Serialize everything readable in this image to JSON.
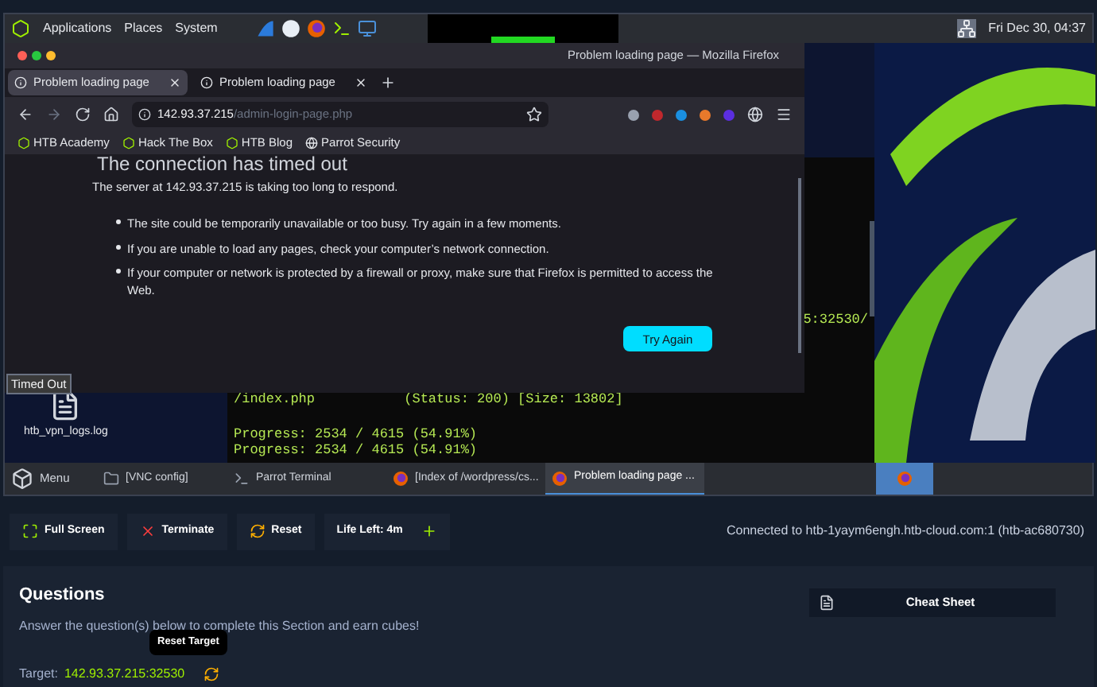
{
  "top_panel": {
    "menus": [
      "Applications",
      "Places",
      "System"
    ],
    "clock": "Fri Dec 30, 04:37"
  },
  "firefox": {
    "title": "Problem loading page — Mozilla Firefox",
    "tabs": [
      {
        "label": "Problem loading page",
        "selected": true
      },
      {
        "label": "Problem loading page",
        "selected": false
      }
    ],
    "url_host": "142.93.37.215",
    "url_path": "/admin-login-page.php",
    "bookmarks": [
      "HTB Academy",
      "Hack The Box",
      "HTB Blog",
      "Parrot Security"
    ],
    "heading": "The connection has timed out",
    "message": "The server at 142.93.37.215 is taking too long to respond.",
    "bullets": [
      "The site could be temporarily unavailable or too busy. Try again in a few moments.",
      "If you are unable to load any pages, check your computer’s network connection.",
      "If your computer or network is protected by a firewall or proxy, make sure that Firefox is permitted to access the Web."
    ],
    "button": "Try Again"
  },
  "tooltip": "Timed Out",
  "desktop_icon": "htb_vpn_logs.log",
  "terminal": {
    "tail": "5:32530/",
    "lines": [
      "/index.php           (Status: 200) [Size: 13802]",
      "Progress: 2534 / 4615 (54.91%)",
      "Progress: 2534 / 4615 (54.91%)"
    ]
  },
  "taskbar": {
    "menu": "Menu",
    "items": [
      {
        "label": "[VNC config]",
        "kind": "window",
        "selected": false
      },
      {
        "label": "Parrot Terminal",
        "kind": "terminal",
        "selected": false
      },
      {
        "label": "[Index of /wordpress/cs...",
        "kind": "browser",
        "selected": false
      },
      {
        "label": "Problem loading page ...",
        "kind": "browser",
        "selected": true
      }
    ]
  },
  "controls": {
    "buttons": [
      {
        "label": "Full Screen",
        "kind": "fullscreen"
      },
      {
        "label": "Terminate",
        "kind": "terminate"
      },
      {
        "label": "Reset",
        "kind": "reset"
      },
      {
        "label": "Life Left: 4m",
        "kind": "life"
      }
    ],
    "connection": "Connected to htb-1yaym6engh.htb-cloud.com:1 (htb-ac680730)"
  },
  "questions": {
    "title": "Questions",
    "subtitle": "Answer the question(s) below to complete this Section and earn cubes!",
    "cheat_sheet": "Cheat Sheet",
    "target_label": "Target:",
    "target": "142.93.37.215:32530",
    "tooltip": "Reset Target"
  }
}
